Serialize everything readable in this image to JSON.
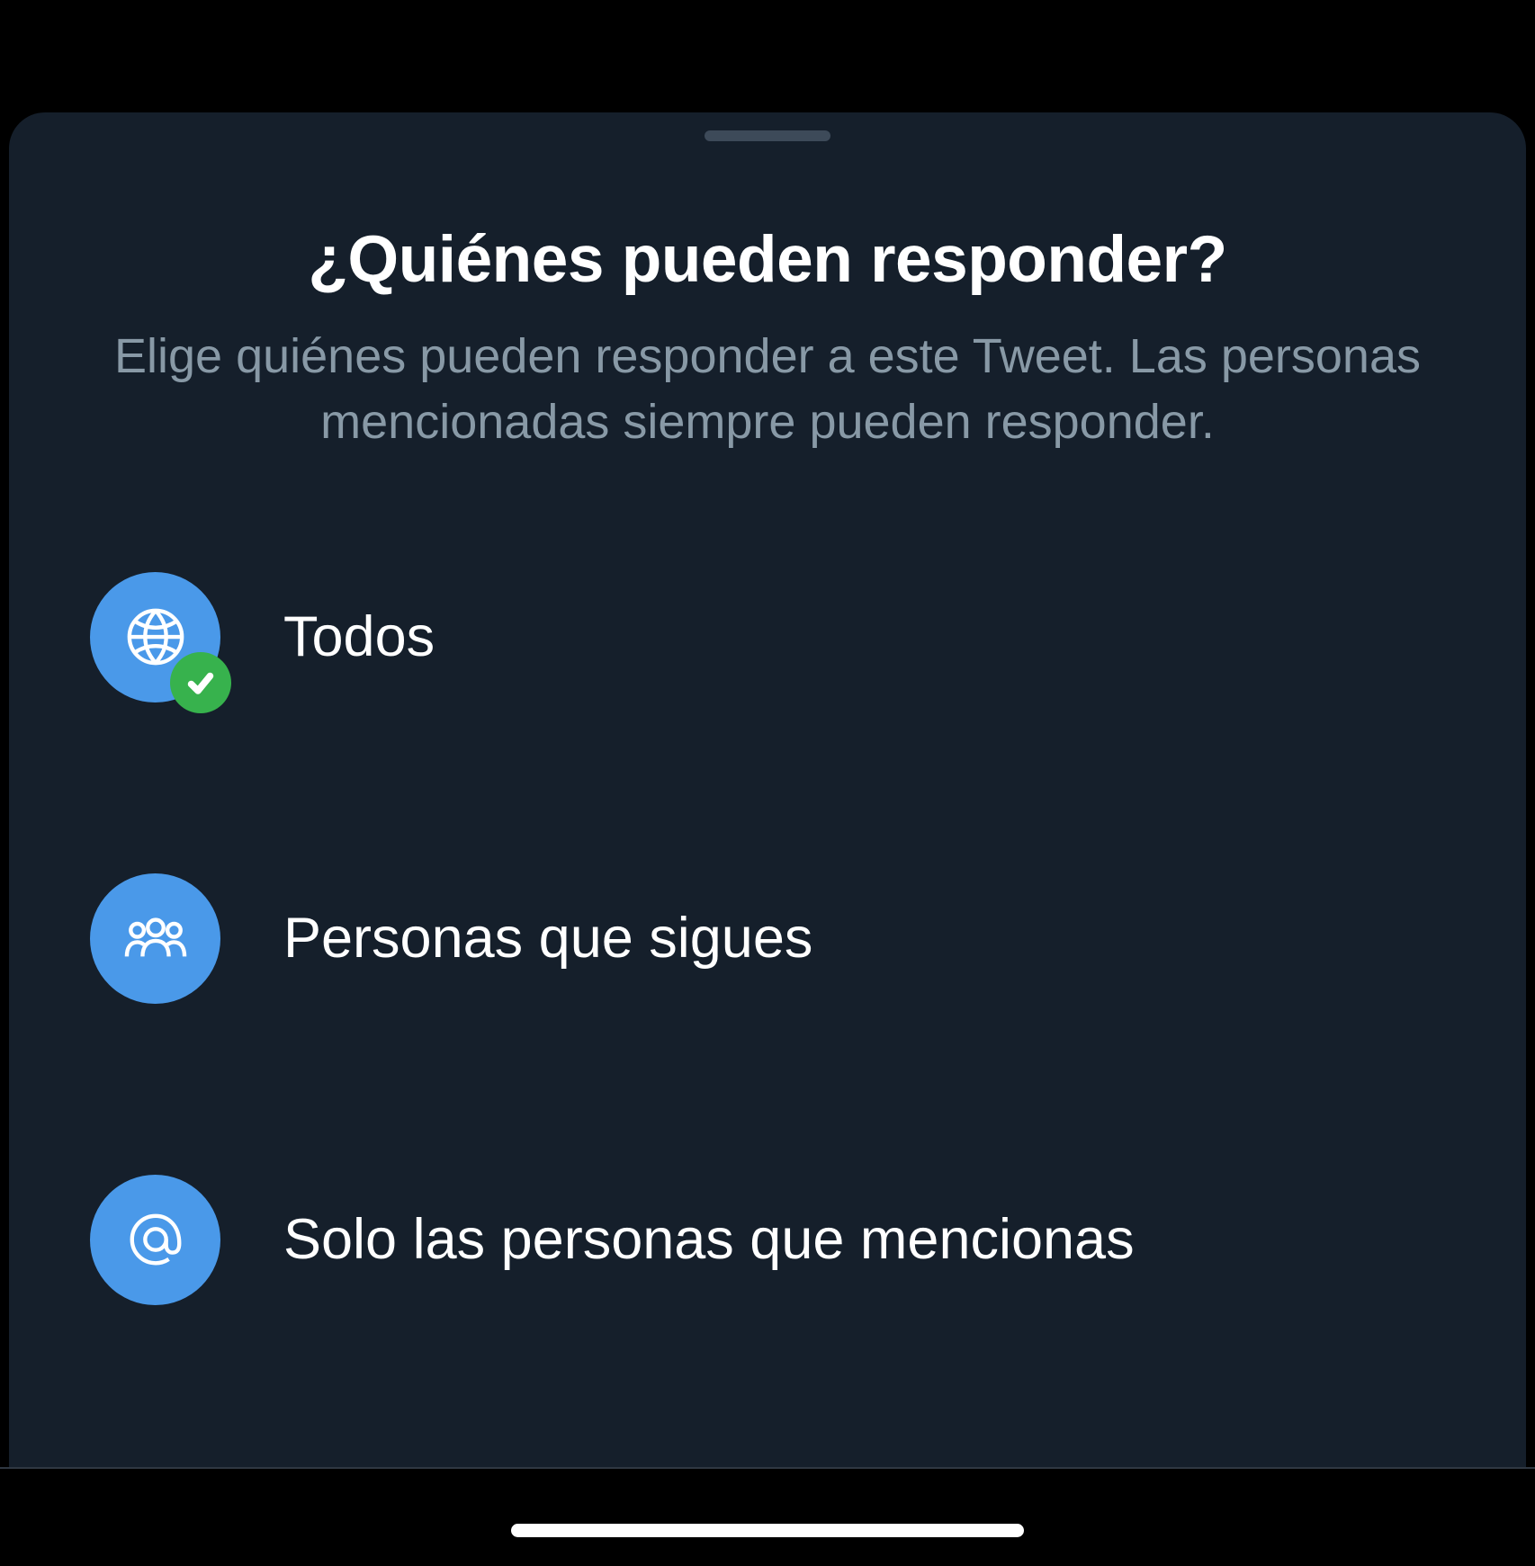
{
  "modal": {
    "title": "¿Quiénes pueden responder?",
    "subtitle": "Elige quiénes pueden responder a este Tweet. Las personas mencionadas siempre pueden responder.",
    "options": [
      {
        "id": "everyone",
        "label": "Todos",
        "icon": "globe-icon",
        "selected": true
      },
      {
        "id": "following",
        "label": "Personas que sigues",
        "icon": "people-icon",
        "selected": false
      },
      {
        "id": "mentioned",
        "label": "Solo las personas que mencionas",
        "icon": "at-icon",
        "selected": false
      }
    ]
  },
  "colors": {
    "accent": "#4a99e9",
    "success": "#37b24d",
    "background": "#000000",
    "sheet": "#151f2b",
    "textPrimary": "#ffffff",
    "textSecondary": "#8899a6"
  }
}
